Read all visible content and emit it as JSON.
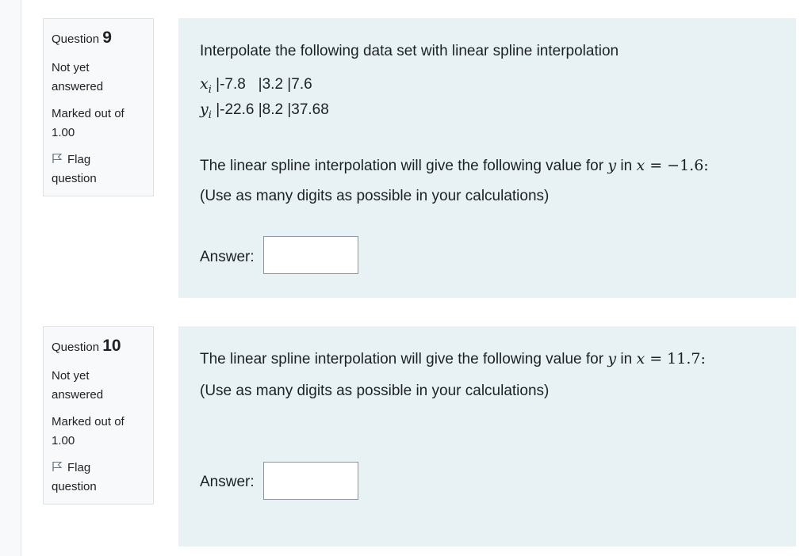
{
  "questions": [
    {
      "label": "Question",
      "number": "9",
      "state": [
        "Not yet",
        "answered"
      ],
      "grade": [
        "Marked out of",
        "1.00"
      ],
      "flag": [
        "Flag",
        "question"
      ],
      "prompt": "Interpolate the following data set with linear spline interpolation",
      "table": {
        "x_label": "x",
        "x_sub": "i",
        "x_values": "|-7.8   |3.2 |7.6",
        "y_label": "y",
        "y_sub": "i",
        "y_values": "|-22.6 |8.2 |37.68"
      },
      "question_text": {
        "before": "The linear spline interpolation will give the following value for ",
        "var_y": "y",
        "mid": " in ",
        "var_x": "x",
        "equals": " = −1.6:"
      },
      "hint": "(Use as many digits as possible in your calculations)",
      "answer_label": "Answer:",
      "answer_value": ""
    },
    {
      "label": "Question",
      "number": "10",
      "state": [
        "Not yet",
        "answered"
      ],
      "grade": [
        "Marked out of",
        "1.00"
      ],
      "flag": [
        "Flag",
        "question"
      ],
      "question_text": {
        "before": "The linear spline interpolation will give the following value for ",
        "var_y": "y",
        "mid": " in ",
        "var_x": "x",
        "equals": " = 11.7:"
      },
      "hint": "(Use as many digits as possible in your calculations)",
      "answer_label": "Answer:",
      "answer_value": ""
    }
  ]
}
